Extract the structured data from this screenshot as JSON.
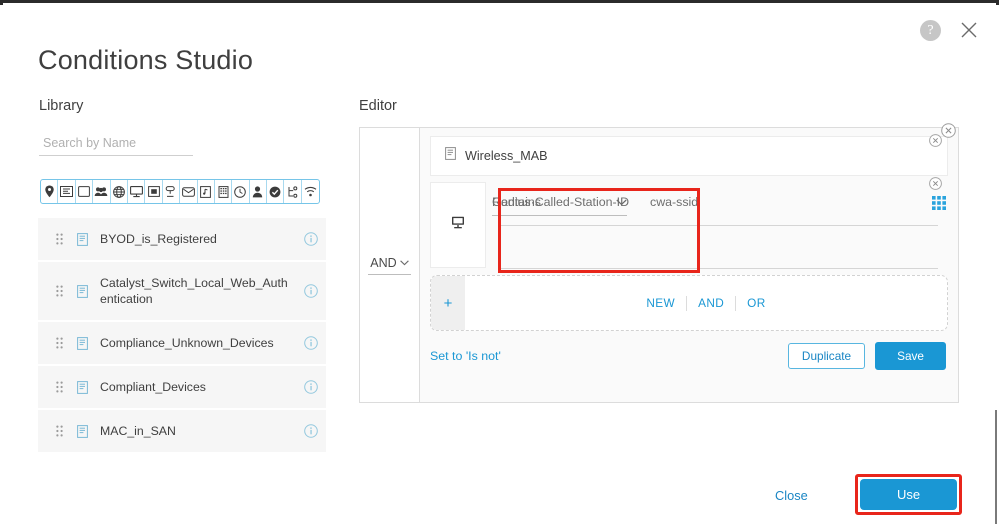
{
  "window": {
    "title": "Conditions Studio",
    "help_icon": "help-circle-icon",
    "close_icon": "close-icon"
  },
  "library": {
    "label": "Library",
    "search": {
      "placeholder": "Search by Name",
      "value": ""
    },
    "filter_icons": [
      "location-pin-icon",
      "network-device-icon",
      "device-blank-icon",
      "identity-group-icon",
      "network-globe-icon",
      "workstation-icon",
      "endpoint-screen-icon",
      "posture-icon",
      "mail-icon",
      "radius-icon",
      "building-icon",
      "time-clock-icon",
      "user-icon",
      "compliance-check-icon",
      "topology-icon",
      "wireless-signal-icon"
    ],
    "items": [
      {
        "name": "BYOD_is_Registered",
        "icon": "condition-doc-icon",
        "info_icon": "info-icon"
      },
      {
        "name": "Catalyst_Switch_Local_Web_Authentication",
        "icon": "condition-doc-icon",
        "info_icon": "info-icon"
      },
      {
        "name": "Compliance_Unknown_Devices",
        "icon": "condition-doc-icon",
        "info_icon": "info-icon"
      },
      {
        "name": "Compliant_Devices",
        "icon": "condition-doc-icon",
        "info_icon": "info-icon"
      },
      {
        "name": "MAC_in_SAN",
        "icon": "condition-doc-icon",
        "info_icon": "info-icon"
      }
    ]
  },
  "editor": {
    "label": "Editor",
    "logic_operator": "AND",
    "condition_name": "Wireless_MAB",
    "condition_icon": "condition-doc-icon",
    "attribute_row": {
      "device_icon": "workstation-icon",
      "attribute": "Radius·Called-Station-ID",
      "operator": "Contains",
      "value": "cwa-ssid",
      "grid_icon": "grid-picker-icon"
    },
    "add_row": {
      "plus": "+",
      "new_label": "NEW",
      "and_label": "AND",
      "or_label": "OR"
    },
    "set_is_not_label": "Set to 'Is not'",
    "duplicate_label": "Duplicate",
    "save_label": "Save",
    "remove_icons": [
      "remove-circle-icon",
      "remove-circle-icon",
      "remove-circle-icon"
    ]
  },
  "footer": {
    "close_label": "Close",
    "use_label": "Use"
  },
  "colors": {
    "accent_blue": "#1a97d4",
    "link_blue": "#1a86c4",
    "annotation_red": "#e8251b",
    "panel_gray": "#f6f6f6",
    "text_dark": "#3f3f3f"
  }
}
